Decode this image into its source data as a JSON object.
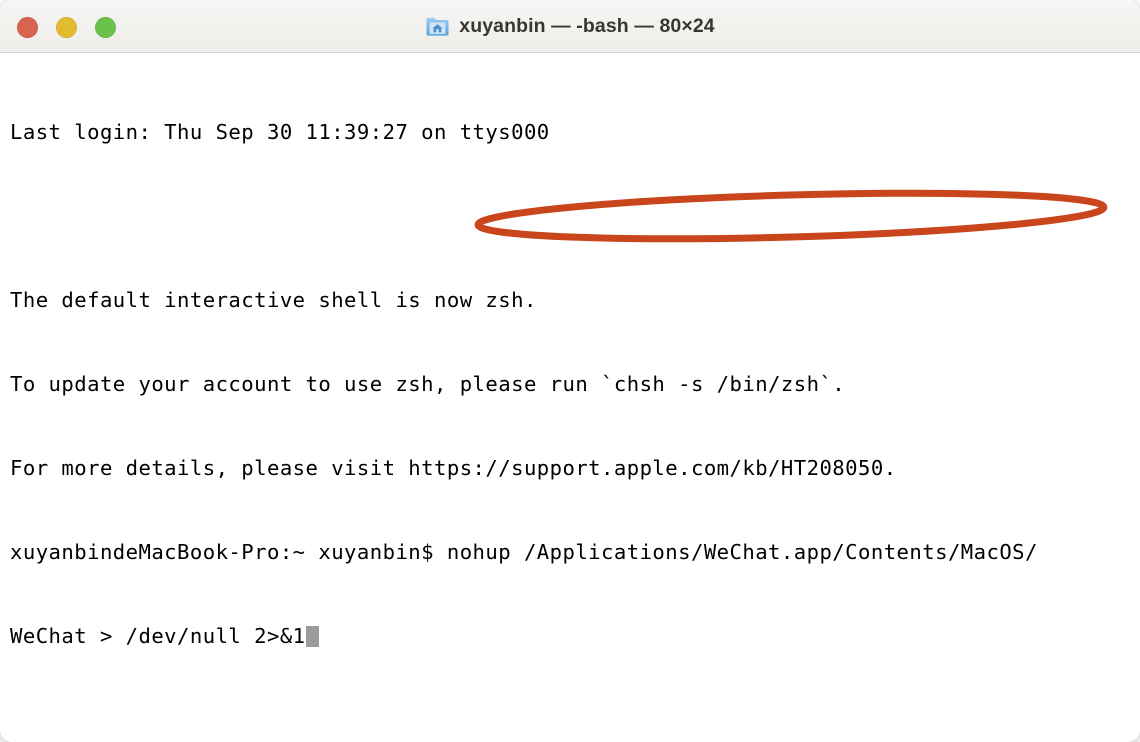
{
  "window": {
    "title": "xuyanbin — -bash — 80×24",
    "icon": "home-folder-icon",
    "traffic_lights": [
      {
        "name": "close",
        "color": "#d9634e"
      },
      {
        "name": "minimize",
        "color": "#e3bb30"
      },
      {
        "name": "maximize",
        "color": "#6cc14a"
      }
    ]
  },
  "terminal": {
    "lines": [
      "Last login: Thu Sep 30 11:39:27 on ttys000",
      "",
      "The default interactive shell is now zsh.",
      "To update your account to use zsh, please run `chsh -s /bin/zsh`.",
      "For more details, please visit https://support.apple.com/kb/HT208050.",
      "xuyanbindeMacBook-Pro:~ xuyanbin$ nohup /Applications/WeChat.app/Contents/MacOS/",
      "WeChat > /dev/null 2>&1"
    ],
    "prompt": "xuyanbindeMacBook-Pro:~ xuyanbin$",
    "command": "nohup /Applications/WeChat.app/Contents/MacOS/WeChat > /dev/null 2>&1",
    "cursor": "block"
  },
  "annotation": {
    "type": "ellipse",
    "color": "#c9451b",
    "stroke_width": 7,
    "target_text": "nohup /Applications/WeChat.app/Contents/MacOS/"
  }
}
